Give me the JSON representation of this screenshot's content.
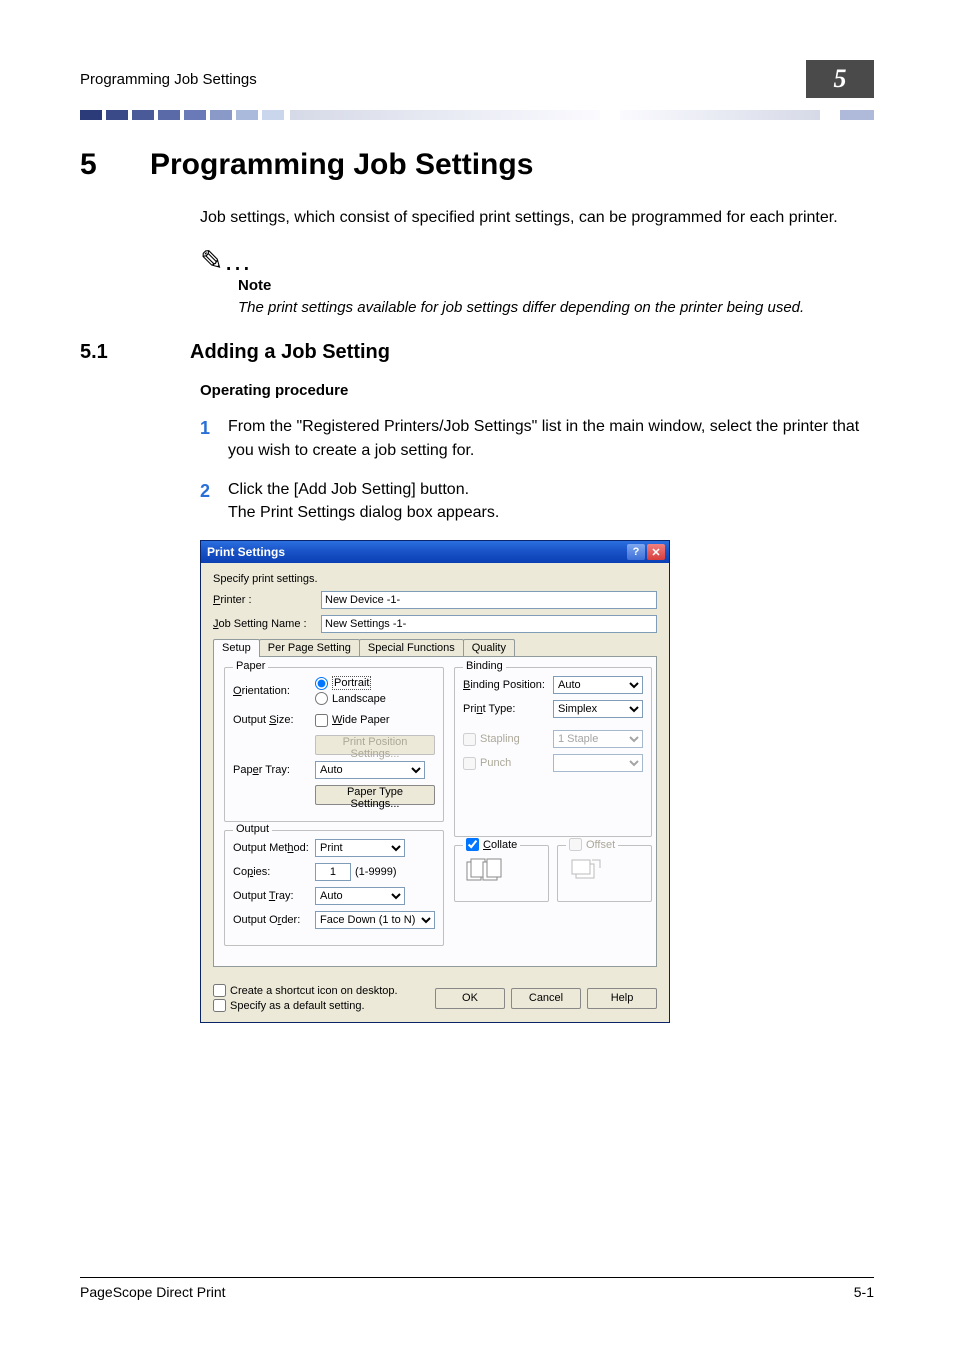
{
  "running_head": {
    "title": "Programming Job Settings",
    "chapnum": "5"
  },
  "chapter": {
    "num": "5",
    "title": "Programming Job Settings"
  },
  "intro": "Job settings, which consist of specified print settings, can be programmed for each printer.",
  "note": {
    "icon": "✎…",
    "label": "Note",
    "text": "The print settings available for job settings differ depending on the printer being used."
  },
  "section": {
    "num": "5.1",
    "title": "Adding a Job Setting"
  },
  "subhead": "Operating procedure",
  "steps": [
    {
      "n": "1",
      "t": "From the \"Registered Printers/Job Settings\" list in the main window, select the printer that you wish to create a job setting for."
    },
    {
      "n": "2",
      "t": "Click the [Add Job Setting] button.\nThe Print Settings dialog box appears."
    }
  ],
  "dialog": {
    "title": "Print Settings",
    "help_glyph": "?",
    "close_glyph": "✕",
    "header_note": "Specify print settings.",
    "printer_label": "Printer :",
    "printer_value": "New Device -1-",
    "jobname_label": "Job Setting Name :",
    "jobname_value": "New Settings -1-",
    "tabs": [
      "Setup",
      "Per Page Setting",
      "Special Functions",
      "Quality"
    ],
    "paper": {
      "legend": "Paper",
      "orientation_label": "Orientation:",
      "portrait": "Portrait",
      "landscape": "Landscape",
      "output_size_label": "Output Size:",
      "wide_paper": "Wide Paper",
      "print_position_btn": "Print Position Settings...",
      "paper_tray_label": "Paper Tray:",
      "paper_tray_value": "Auto",
      "paper_type_btn": "Paper Type Settings..."
    },
    "binding": {
      "legend": "Binding",
      "binding_position_label": "Binding Position:",
      "binding_position_value": "Auto",
      "print_type_label": "Print Type:",
      "print_type_value": "Simplex",
      "stapling_label": "Stapling",
      "stapling_value": "1 Staple",
      "punch_label": "Punch"
    },
    "output": {
      "legend": "Output",
      "method_label": "Output Method:",
      "method_value": "Print",
      "copies_label": "Copies:",
      "copies_value": "1",
      "copies_range": "(1-9999)",
      "tray_label": "Output Tray:",
      "tray_value": "Auto",
      "order_label": "Output Order:",
      "order_value": "Face Down (1 to N)"
    },
    "collate_label": "Collate",
    "offset_label": "Offset",
    "create_shortcut": "Create a shortcut icon on desktop.",
    "specify_default": "Specify as a default setting.",
    "ok": "OK",
    "cancel": "Cancel",
    "help": "Help"
  },
  "footer": {
    "left": "PageScope Direct Print",
    "right": "5-1"
  }
}
